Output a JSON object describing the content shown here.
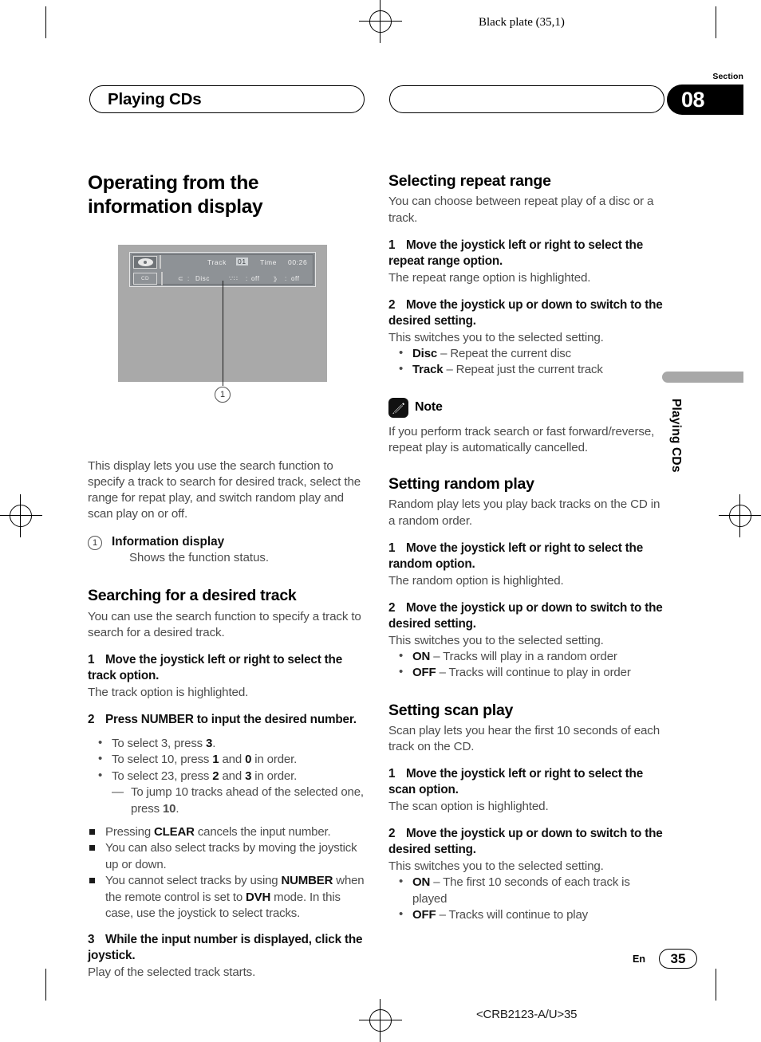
{
  "page": {
    "plate_text": "Black plate (35,1)",
    "section_label": "Section",
    "section_number": "08",
    "running_head": "Playing CDs",
    "side_tab_text": "Playing CDs",
    "footer_language": "En",
    "footer_page_number": "35",
    "footer_code": "<CRB2123-A/U>35"
  },
  "illustration": {
    "callout_number": "1",
    "lcd": {
      "disc_icon_name": "cd-disc-icon",
      "source_label": "CD",
      "track_label": "Track",
      "track_value": "01",
      "time_label": "Time",
      "time_value": "00:26",
      "repeat_icon": "⊂",
      "repeat_sep": ":",
      "repeat_value": "Disc",
      "random_icon": "∵∷",
      "random_sep": ":",
      "random_value": "off",
      "scan_icon": "》",
      "scan_sep": ":",
      "scan_value": "off"
    }
  },
  "left_column": {
    "title": "Operating from the information display",
    "intro": "This display lets you use the search function to specify a track to search for desired track, select the range for repat play, and switch random play and scan play on or off.",
    "callout_item": {
      "number": "1",
      "title": "Information display",
      "description": "Shows the function status."
    },
    "search_section": {
      "heading": "Searching for a desired track",
      "intro": "You can use the search function to specify a track to search for a desired track.",
      "step1_num": "1",
      "step1_text": "Move the joystick left or right to select the track option.",
      "step1_result": "The track option is highlighted.",
      "step2_num": "2",
      "step2_text": "Press NUMBER to input the desired number.",
      "bullets": [
        "To select 3, press <b>3</b>.",
        "To select 10, press <b>1</b> and <b>0</b> in order.",
        "To select 23, press <b>2</b> and <b>3</b> in order."
      ],
      "dash_note": "To jump 10 tracks ahead of the selected one, press <b>10</b>.",
      "square_notes": [
        "Pressing <b>CLEAR</b> cancels the input number.",
        "You can also select tracks by moving the joystick up or down.",
        "You cannot select tracks by using <b>NUMBER</b> when the remote control is set to <b>DVH</b> mode. In this case, use the joystick to select tracks."
      ],
      "step3_num": "3",
      "step3_text": "While the input number is displayed, click the joystick.",
      "step3_result": "Play of the selected track starts."
    }
  },
  "right_column": {
    "repeat_section": {
      "heading": "Selecting repeat range",
      "intro": "You can choose between repeat play of a disc or a track.",
      "step1_num": "1",
      "step1_text": "Move the joystick left or right to select the repeat range option.",
      "step1_result": "The repeat range option is highlighted.",
      "step2_num": "2",
      "step2_text": "Move the joystick up or down to switch to the desired setting.",
      "step2_result": "This switches you to the selected setting.",
      "options": [
        "<b>Disc</b> – Repeat the current disc",
        "<b>Track</b> – Repeat just the current track"
      ]
    },
    "note": {
      "icon_name": "pencil-note-icon",
      "label": "Note",
      "text": "If you perform track search or fast forward/reverse, repeat play is automatically cancelled."
    },
    "random_section": {
      "heading": "Setting random play",
      "intro": "Random play lets you play back tracks on the CD in a random order.",
      "step1_num": "1",
      "step1_text": "Move the joystick left or right to select the random option.",
      "step1_result": "The random option is highlighted.",
      "step2_num": "2",
      "step2_text": "Move the joystick up or down to switch to the desired setting.",
      "step2_result": "This switches you to the selected setting.",
      "options": [
        "<b>ON</b> – Tracks will play in a random order",
        "<b>OFF</b> – Tracks will continue to play in order"
      ]
    },
    "scan_section": {
      "heading": "Setting scan play",
      "intro": "Scan play lets you hear the first 10 seconds of each track on the CD.",
      "step1_num": "1",
      "step1_text": "Move the joystick left or right to select the scan option.",
      "step1_result": "The scan option is highlighted.",
      "step2_num": "2",
      "step2_text": "Move the joystick up or down to switch to the desired setting.",
      "step2_result": "This switches you to the selected setting.",
      "options": [
        "<b>ON</b> – The first 10 seconds of each track is played",
        "<b>OFF</b> – Tracks will continue to play"
      ]
    }
  }
}
